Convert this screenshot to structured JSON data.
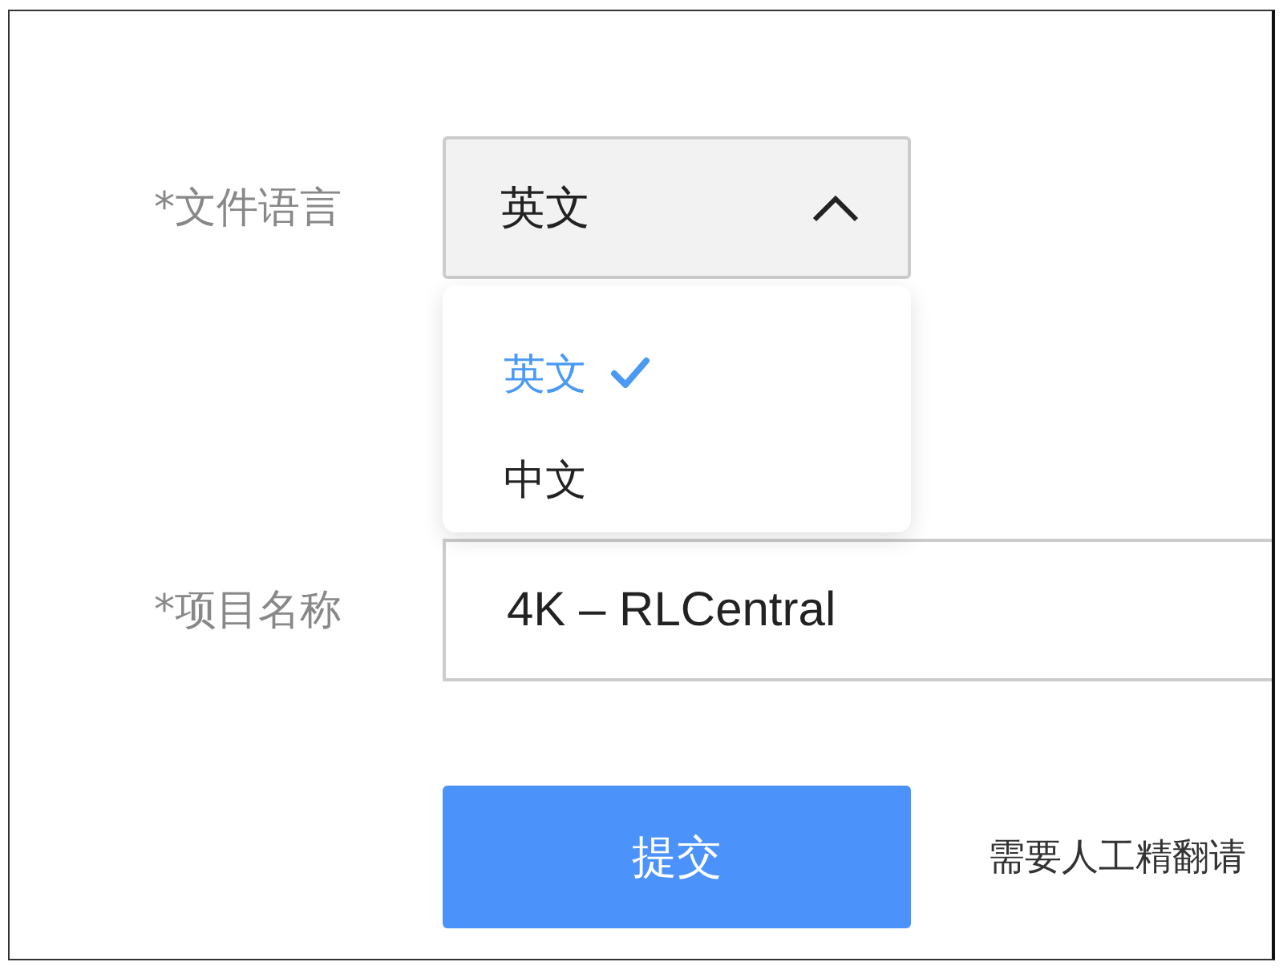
{
  "fields": [
    {
      "kind": "select",
      "label": "*文件语言",
      "value": "英文",
      "expanded": true,
      "options": [
        {
          "label": "英文",
          "selected": true
        },
        {
          "label": "中文",
          "selected": false
        }
      ]
    },
    {
      "kind": "text",
      "label": "*项目名称",
      "value": "4K – RLCentral"
    }
  ],
  "submit_button": "提交",
  "side_note": "需要人工精翻请"
}
